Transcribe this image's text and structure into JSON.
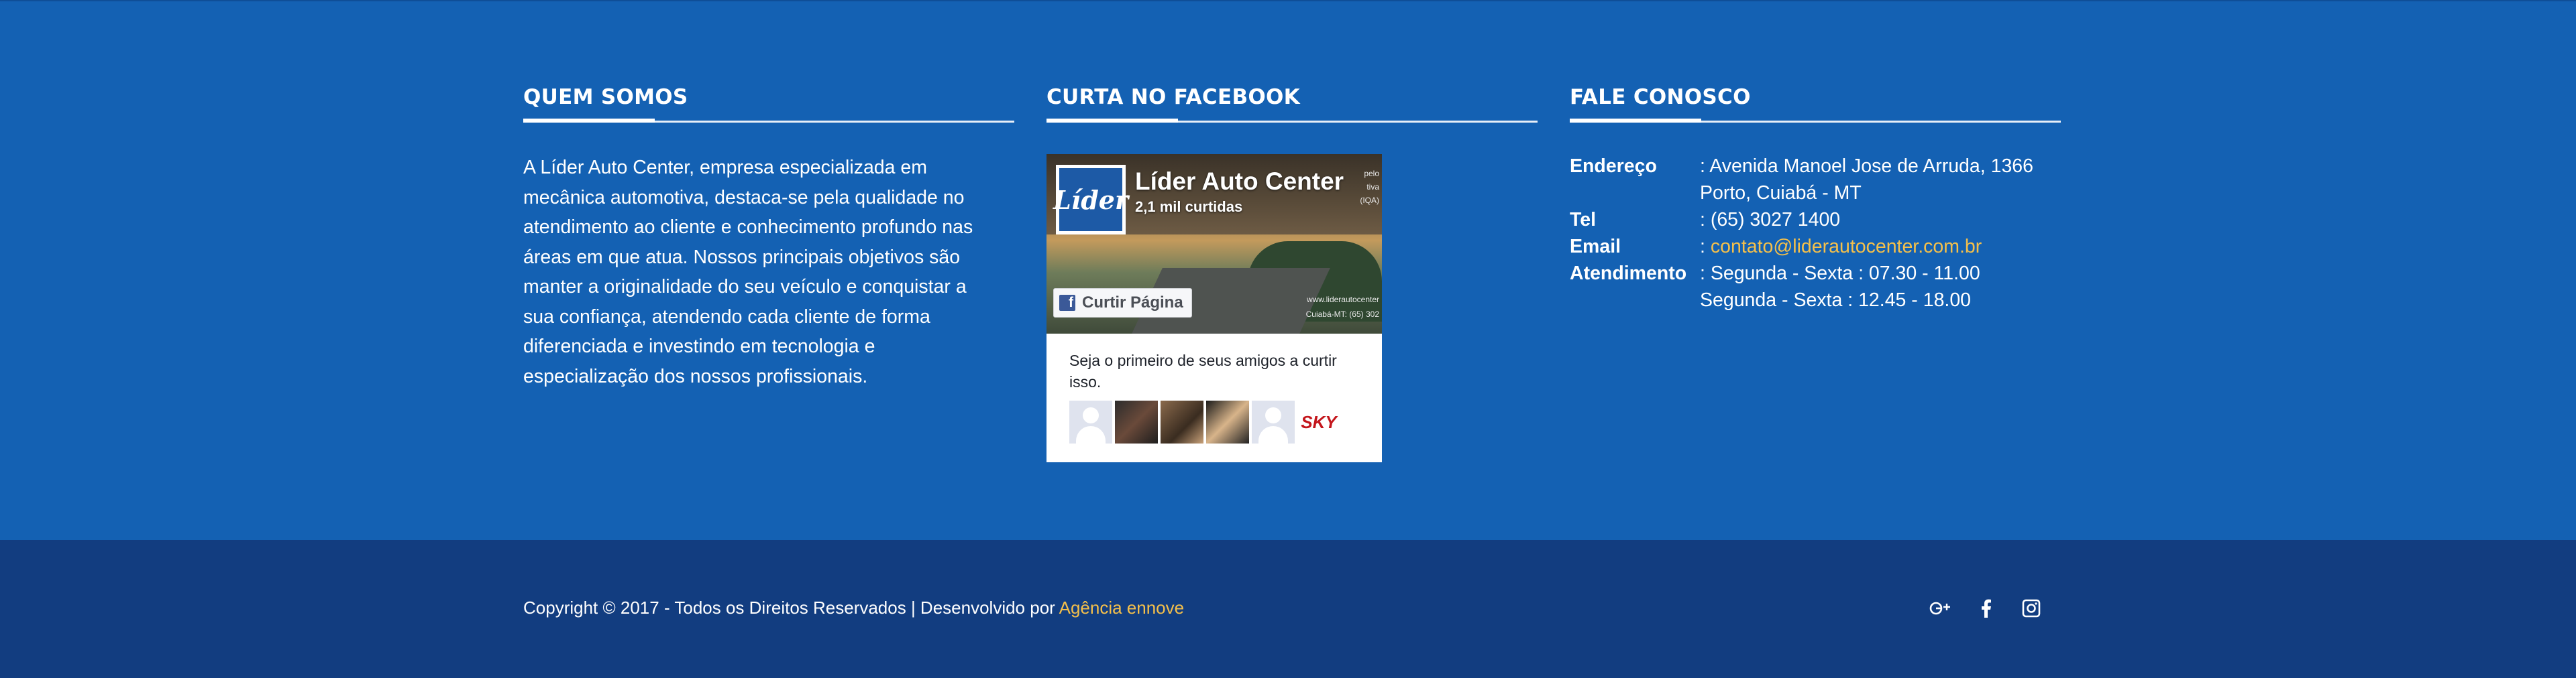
{
  "about": {
    "heading": "QUEM SOMOS",
    "lines": [
      "A Líder Auto Center, empresa especializada em",
      "mecânica automotiva, destaca-se pela qualidade no",
      "atendimento ao cliente e conhecimento profundo nas",
      "áreas em que atua. Nossos principais objetivos são",
      "manter a originalidade do seu veículo e conquistar a",
      "sua confiança, atendendo cada cliente de forma",
      "diferenciada e investindo em tecnologia e",
      "especialização dos nossos profissionais."
    ]
  },
  "facebook": {
    "heading": "CURTA NO FACEBOOK",
    "page_name": "Líder Auto Center",
    "logo_text": "Líder",
    "likes": "2,1 mil curtidas",
    "like_button": "Curtir Página",
    "cover_text_1": "pelo",
    "cover_text_2": "tiva",
    "cover_text_3": "(IQA)",
    "cover_site": "www.liderautocenter",
    "cover_city": "Cuiabá-MT: (65) 302",
    "friends_text": "Seja o primeiro de seus amigos a curtir isso.",
    "sky_label": "SKY"
  },
  "contact": {
    "heading": "FALE CONOSCO",
    "address_label": "Endereço",
    "address_1": ": Avenida Manoel Jose de Arruda, 1366",
    "address_2": "Porto, Cuiabá - MT",
    "tel_label": "Tel",
    "tel": ": (65) 3027 1400",
    "email_label": "Email",
    "email_prefix": ": ",
    "email": "contato@liderautocenter.com.br",
    "hours_label": "Atendimento",
    "hours_1": ": Segunda - Sexta : 07.30 - 11.00",
    "hours_2": "Segunda - Sexta : 12.45 - 18.00"
  },
  "footer": {
    "copyright": "Copyright © 2017 - Todos os Direitos Reservados | Desenvolvido por ",
    "agency": "Agência ennove",
    "social": [
      "google-plus-icon",
      "facebook-icon",
      "instagram-icon"
    ]
  },
  "colors": {
    "footer_top": "#1461b3",
    "footer_bottom": "#123d80",
    "accent": "#f5c04a"
  }
}
